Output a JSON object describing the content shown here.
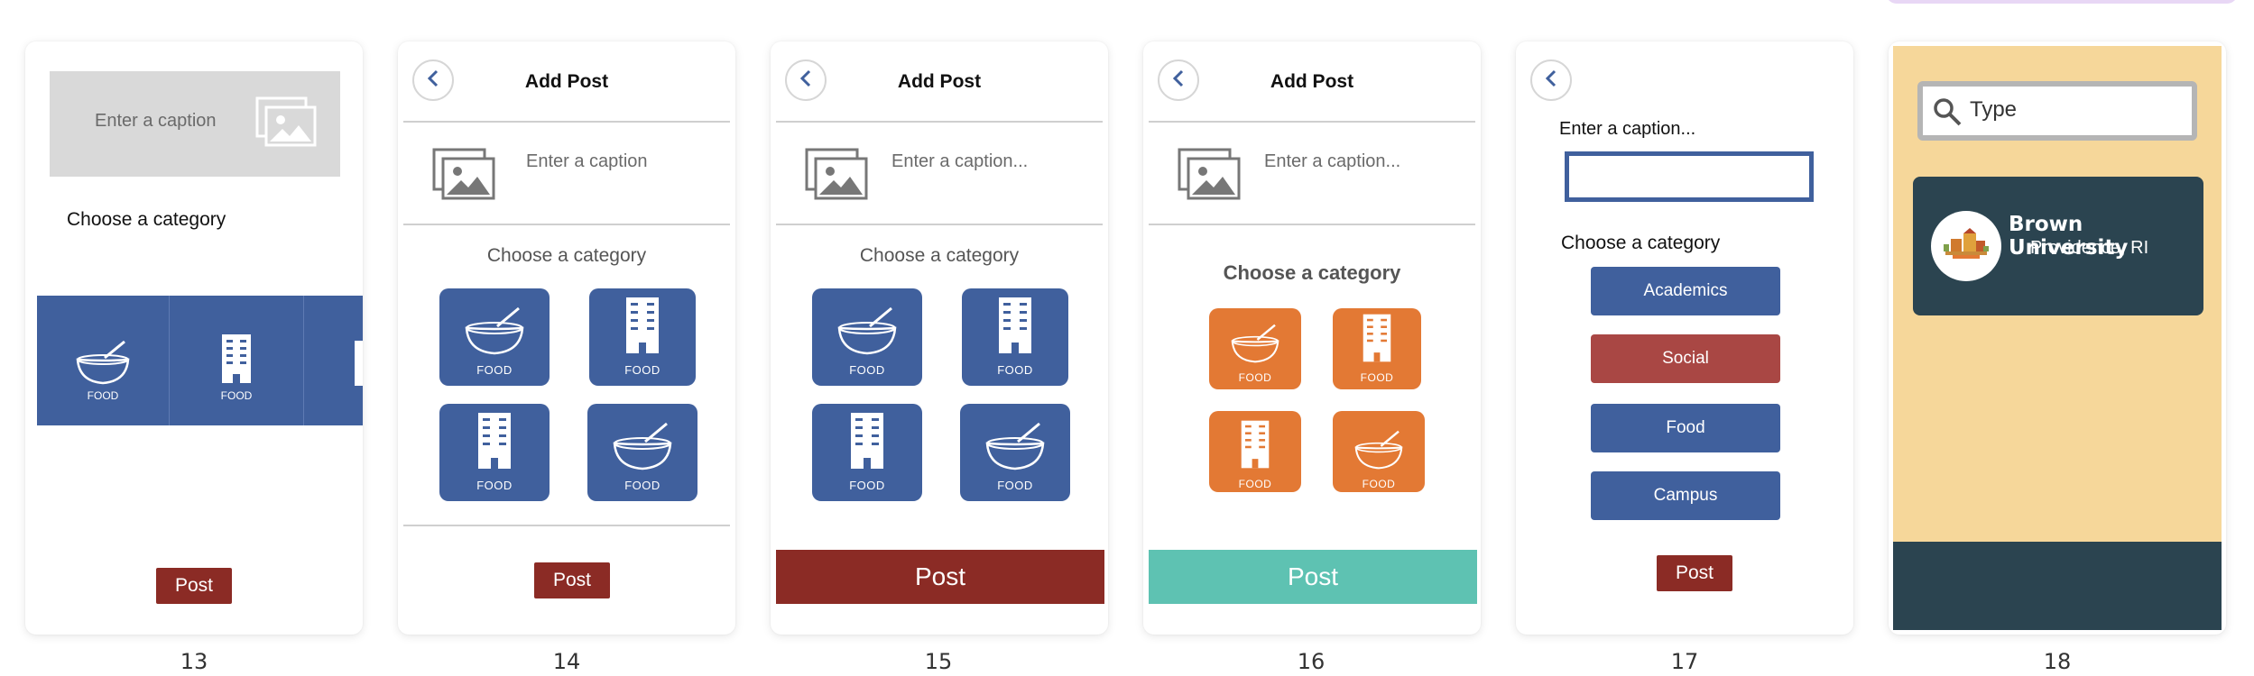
{
  "top_right_tab": {
    "color": "#e8d7f5"
  },
  "colors": {
    "blue": "#40609d",
    "red": "#8b2b25",
    "orange": "#e37934",
    "teal": "#5ec2b2",
    "social_red": "#a94744",
    "panel_yellow": "#f6d79a",
    "panel_dark": "#2b4450"
  },
  "screens": [
    {
      "number": "13",
      "caption_placeholder": "Enter a caption",
      "category_label": "Choose a category",
      "carousel": [
        {
          "label": "FOOD",
          "icon": "bowl-icon"
        },
        {
          "label": "FOOD",
          "icon": "building-icon"
        }
      ],
      "post_label": "Post"
    },
    {
      "number": "14",
      "title": "Add Post",
      "caption_placeholder": "Enter a caption",
      "category_label": "Choose a category",
      "tiles": [
        {
          "label": "FOOD",
          "icon": "bowl-icon"
        },
        {
          "label": "FOOD",
          "icon": "building-icon"
        },
        {
          "label": "FOOD",
          "icon": "building-icon"
        },
        {
          "label": "FOOD",
          "icon": "bowl-icon"
        }
      ],
      "post_label": "Post"
    },
    {
      "number": "15",
      "title": "Add Post",
      "caption_placeholder": "Enter a caption...",
      "category_label": "Choose a category",
      "tiles": [
        {
          "label": "FOOD",
          "icon": "bowl-icon"
        },
        {
          "label": "FOOD",
          "icon": "building-icon"
        },
        {
          "label": "FOOD",
          "icon": "building-icon"
        },
        {
          "label": "FOOD",
          "icon": "bowl-icon"
        }
      ],
      "post_label": "Post"
    },
    {
      "number": "16",
      "title": "Add Post",
      "caption_placeholder": "Enter a caption...",
      "category_label": "Choose a category",
      "tiles": [
        {
          "label": "FOOD",
          "icon": "bowl-icon"
        },
        {
          "label": "FOOD",
          "icon": "building-icon"
        },
        {
          "label": "FOOD",
          "icon": "building-icon"
        },
        {
          "label": "FOOD",
          "icon": "bowl-icon"
        }
      ],
      "post_label": "Post"
    },
    {
      "number": "17",
      "caption_label": "Enter a caption...",
      "caption_value": "",
      "category_label": "Choose a category",
      "categories": [
        "Academics",
        "Social",
        "Food",
        "Campus"
      ],
      "post_label": "Post"
    },
    {
      "number": "18",
      "search_placeholder": "Type",
      "university": {
        "name": "Brown University",
        "location": "Providence, RI"
      }
    }
  ]
}
